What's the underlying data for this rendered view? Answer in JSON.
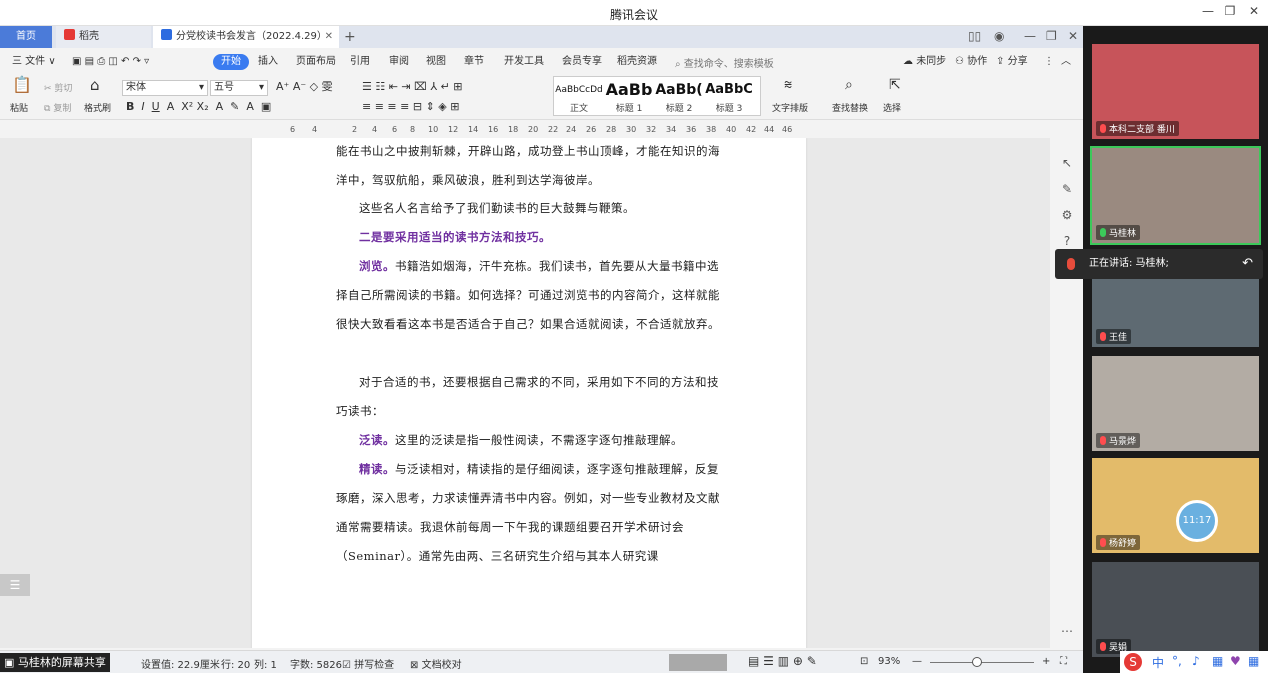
{
  "app": {
    "title": "腾讯会议",
    "minimize": "—",
    "maximize": "❐",
    "close": "✕"
  },
  "wps": {
    "tabs": {
      "home": "首页",
      "daoke": "稻壳",
      "doc": "分党校读书会发言（2022.4.29）"
    },
    "menus": [
      "三 文件 ∨",
      "开始",
      "插入",
      "页面布局",
      "引用",
      "审阅",
      "视图",
      "章节",
      "开发工具",
      "会员专享",
      "稻壳资源"
    ],
    "search_placeholder": "查找命令、搜索模板",
    "right_actions": {
      "sync": "未同步",
      "collab": "协作",
      "share": "分享"
    },
    "ribbon": {
      "paste": "粘贴",
      "cut": "剪切",
      "copy": "复制",
      "format_painter": "格式刷",
      "font_name": "宋体",
      "font_size": "五号",
      "styles": [
        {
          "sample": "AaBbCcDd",
          "label": "正文"
        },
        {
          "sample": "AaBb",
          "label": "标题 1"
        },
        {
          "sample": "AaBb(",
          "label": "标题 2"
        },
        {
          "sample": "AaBbC",
          "label": "标题 3"
        }
      ],
      "text_layout": "文字排版",
      "find_replace": "查找替换",
      "select": "选择"
    },
    "ruler_ticks": [
      "6",
      "4",
      "2",
      "2",
      "4",
      "6",
      "8",
      "10",
      "12",
      "14",
      "16",
      "18",
      "20",
      "22",
      "24",
      "26",
      "28",
      "30",
      "32",
      "34",
      "36",
      "38",
      "40",
      "42",
      "44",
      "46"
    ],
    "doc": {
      "p1": "能在书山之中披荆斩棘，开辟山路，成功登上书山顶峰，才能在知识的海洋中，驾驭航船，乘风破浪，胜利到达学海彼岸。",
      "p2": "这些名人名言给予了我们勤读书的巨大鼓舞与鞭策。",
      "h2": "二是要采用适当的读书方法和技巧。",
      "p3_bold": "浏览。",
      "p3": "书籍浩如烟海，汗牛充栋。我们读书，首先要从大量书籍中选择自己所需阅读的书籍。如何选择？可通过浏览书的内容简介，这样就能很快大致看看这本书是否适合于自己？如果合适就阅读，不合适就放弃。",
      "p4": "对于合适的书，还要根据自己需求的不同，采用如下不同的方法和技巧读书：",
      "p5_bold": "泛读。",
      "p5": "这里的泛读是指一般性阅读，不需逐字逐句推敲理解。",
      "p6_bold": "精读。",
      "p6": "与泛读相对，精读指的是仔细阅读，逐字逐句推敲理解，反复琢磨，深入思考，力求读懂弄清书中内容。例如，对一些专业教材及文献通常需要精读。我退休前每周一下午我的课题组要召开学术研讨会（Seminar）。通常先由两、三名研究生介绍与其本人研究课"
    },
    "status": {
      "share_label": "马桂林的屏幕共享",
      "setting": "设置值: 22.9厘米",
      "row": "行: 20",
      "col": "列: 1",
      "word_count": "字数: 5826",
      "spell": "拼写检查",
      "proof": "文档校对",
      "zoom": "93%"
    }
  },
  "meeting": {
    "participants": [
      {
        "name": "本科二支部 番川",
        "mic_on": false
      },
      {
        "name": "马桂林",
        "mic_on": true
      },
      {
        "name": "王佳",
        "mic_on": false
      },
      {
        "name": "马景烨",
        "mic_on": false
      },
      {
        "name": "杨舒婷",
        "mic_on": false
      },
      {
        "name": "吴娟",
        "mic_on": false
      }
    ],
    "speaking": "正在讲话: 马桂林;",
    "clock": "11:17",
    "tray": [
      "S",
      "中",
      "°,",
      "♪",
      "▦",
      "♥",
      "▦"
    ]
  }
}
